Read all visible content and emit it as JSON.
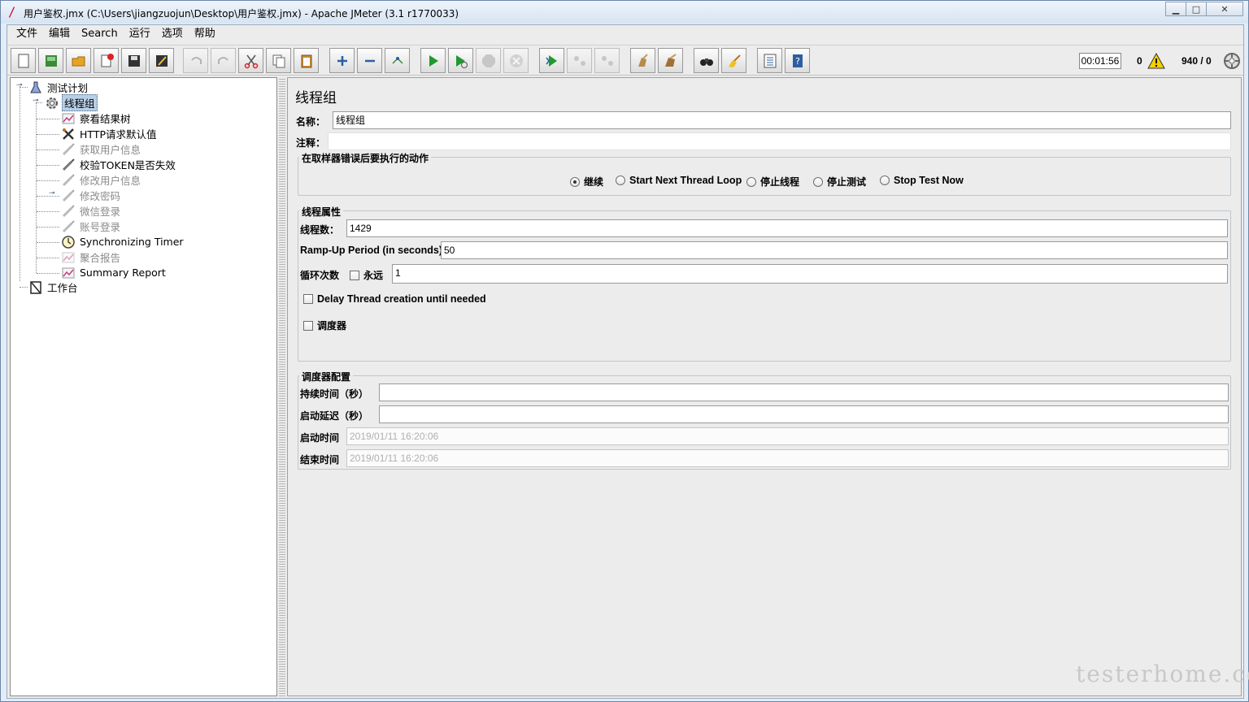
{
  "window": {
    "title": "用户鉴权.jmx (C:\\Users\\jiangzuojun\\Desktop\\用户鉴权.jmx) - Apache JMeter (3.1 r1770033)",
    "minimize": "▭",
    "maximize": "□",
    "close": "✕"
  },
  "menu": [
    "文件",
    "编辑",
    "Search",
    "运行",
    "选项",
    "帮助"
  ],
  "toolbar": {
    "timer": "00:01:56",
    "error_count": "0",
    "thread_count": "940 / 0"
  },
  "tree": {
    "test_plan": "测试计划",
    "thread_group": "线程组",
    "children": [
      {
        "label": "察看结果树",
        "enabled": true,
        "icon": "chart-icon"
      },
      {
        "label": "HTTP请求默认值",
        "enabled": true,
        "icon": "tools-icon"
      },
      {
        "label": "获取用户信息",
        "enabled": false,
        "icon": "pipette-icon"
      },
      {
        "label": "校验TOKEN是否失效",
        "enabled": true,
        "icon": "pipette-icon"
      },
      {
        "label": "修改用户信息",
        "enabled": false,
        "icon": "pipette-icon"
      },
      {
        "label": "修改密码",
        "enabled": false,
        "icon": "pipette-icon"
      },
      {
        "label": "微信登录",
        "enabled": false,
        "icon": "pipette-icon"
      },
      {
        "label": "账号登录",
        "enabled": false,
        "icon": "pipette-icon"
      },
      {
        "label": "Synchronizing Timer",
        "enabled": true,
        "icon": "clock-icon"
      },
      {
        "label": "聚合报告",
        "enabled": false,
        "icon": "chart-icon"
      },
      {
        "label": "Summary Report",
        "enabled": true,
        "icon": "chart-icon"
      }
    ],
    "workbench": "工作台"
  },
  "form": {
    "title": "线程组",
    "name_label": "名称：",
    "name_value": "线程组",
    "comment_label": "注释：",
    "comment_value": "",
    "error_action": {
      "title": "在取样器错误后要执行的动作",
      "options": [
        "继续",
        "Start Next Thread Loop",
        "停止线程",
        "停止测试",
        "Stop Test Now"
      ],
      "selected": "继续"
    },
    "thread_props": {
      "title": "线程属性",
      "threads_label": "线程数：",
      "threads_value": "1429",
      "rampup_label": "Ramp-Up Period (in seconds):",
      "rampup_value": "50",
      "loop_label": "循环次数",
      "forever_label": "永远",
      "loop_value": "1",
      "delay_label": "Delay Thread creation until needed",
      "scheduler_label": "调度器"
    },
    "scheduler": {
      "title": "调度器配置",
      "duration_label": "持续时间（秒）",
      "duration_value": "",
      "delay_label": "启动延迟（秒）",
      "delay_value": "",
      "start_label": "启动时间",
      "start_value": "2019/01/11 16:20:06",
      "end_label": "结束时间",
      "end_value": "2019/01/11 16:20:06"
    }
  },
  "watermark": "testerhome.com"
}
